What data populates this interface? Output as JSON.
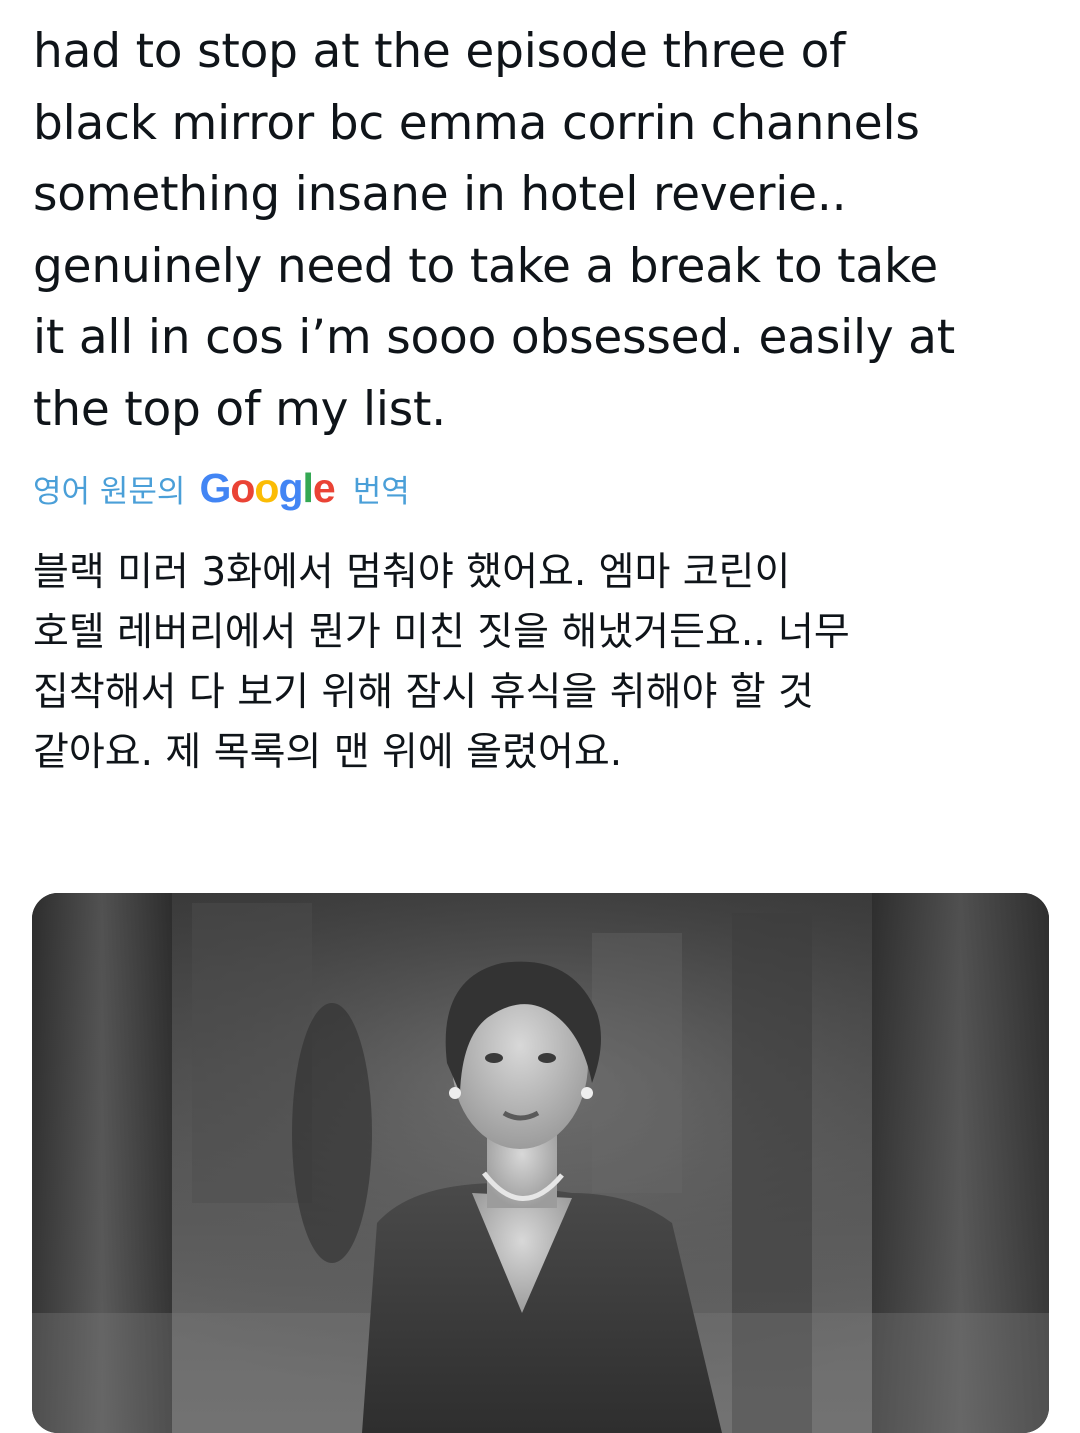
{
  "post": {
    "text": "had to stop at the episode three of\nblack  mirror bc emma corrin channels\nsomething insane in hotel reverie..\ngenuinely need to take a break to take\nit all in cos i’m sooo obsessed. easily at\nthe top of my list.",
    "translate": {
      "prefix": "영어 원문의",
      "brand": "Google",
      "suffix": "번역",
      "brand_colors": [
        "#4285F4",
        "#EA4335",
        "#FBBC05",
        "#4285F4",
        "#34A853",
        "#EA4335"
      ]
    },
    "translated_text": "블랙 미러 3화에서 멈춰야 했어요. 엠마 코린이\n호텔 레버리에서 뭔가 미친 짓을 해냈거든요.. 너무\n집착해서 다 보기 위해 잠시 휴식을 취해야 할 것\n같아요. 제 목록의 맨 위에 올렸어요."
  },
  "media": {
    "type": "photo",
    "style": "black-and-white still of a woman in a vintage hotel lobby"
  },
  "colors": {
    "text": "#0f1419",
    "link": "#4a9fd8",
    "background": "#ffffff"
  }
}
